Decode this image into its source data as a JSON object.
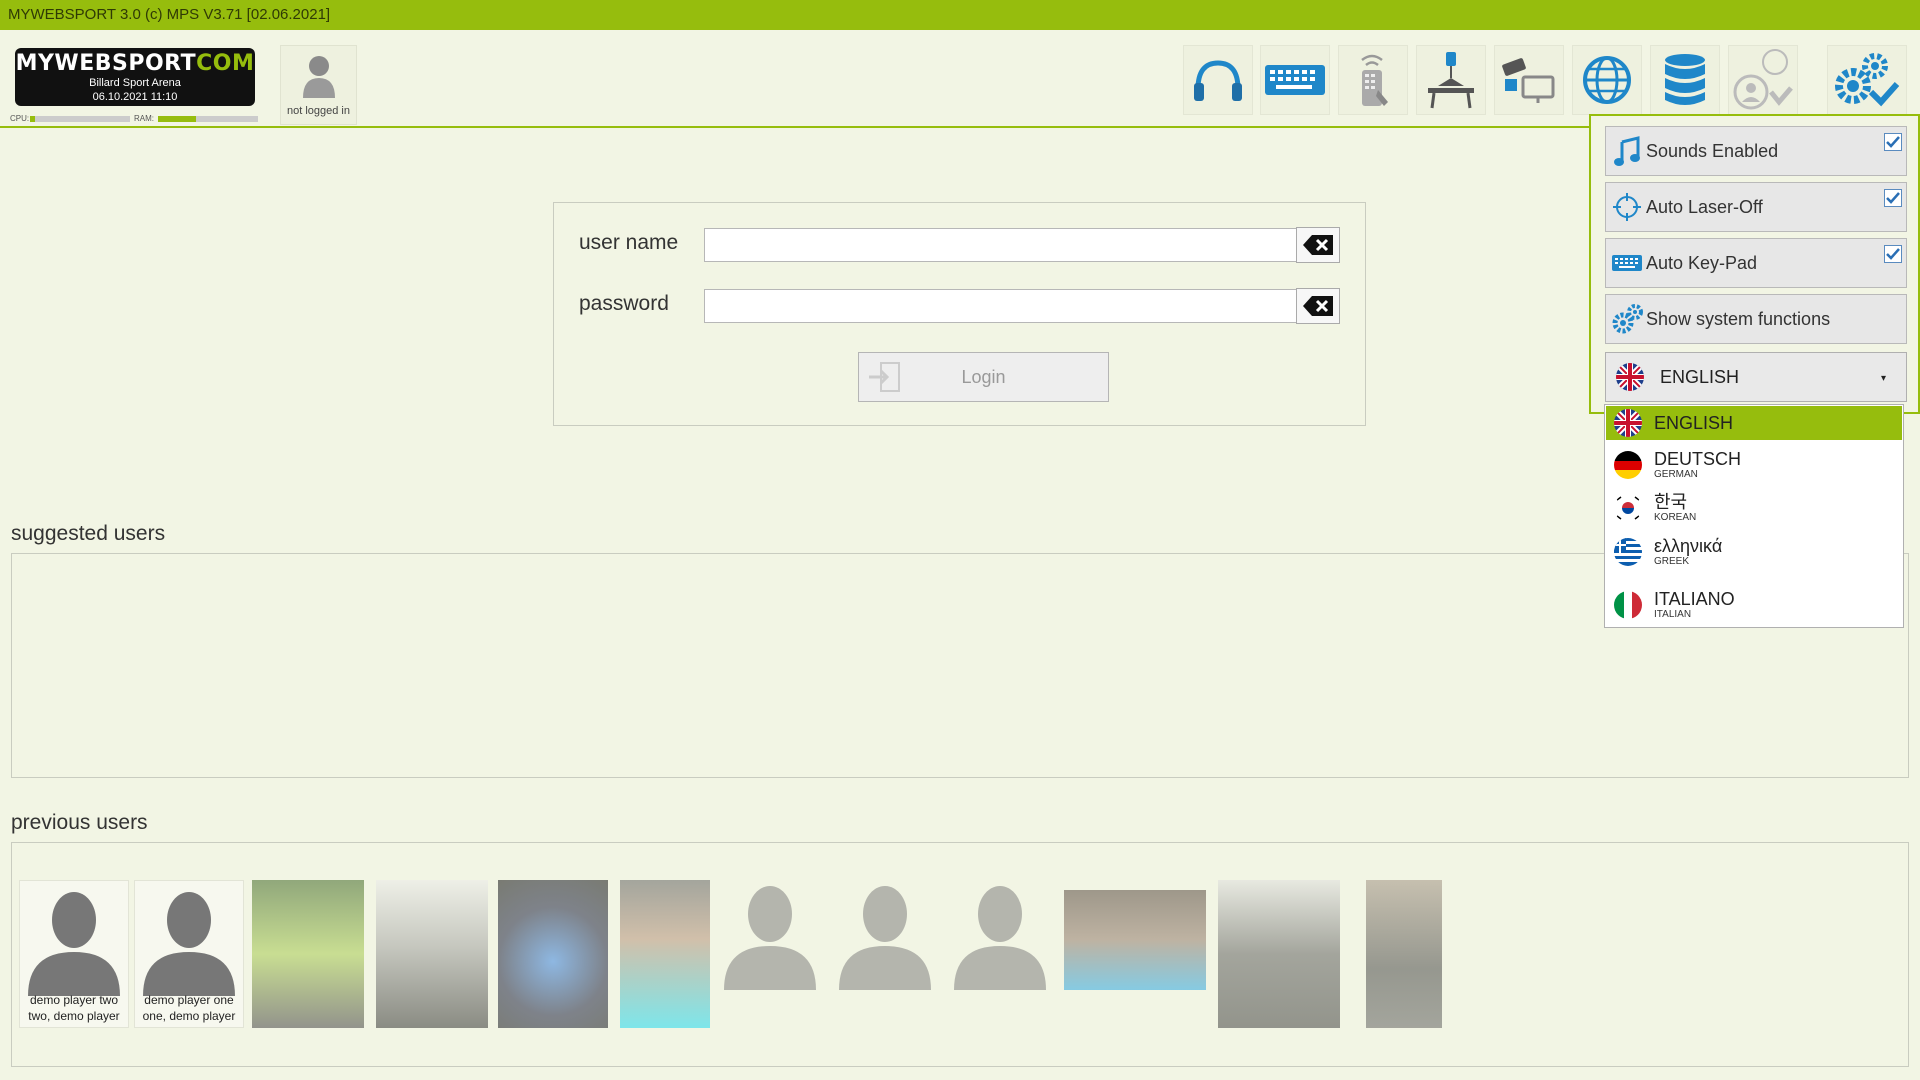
{
  "titlebar": {
    "text": "MYWEBSPORT 3.0  (c) MPS V3.71 [02.06.2021]"
  },
  "logo": {
    "brand_white": "MYWEBSPORT",
    "brand_green": "COM",
    "venue": "Billard Sport Arena",
    "datetime": "06.10.2021  11:10"
  },
  "meters": {
    "cpu_label": "CPU:",
    "ram_label": "RAM:",
    "cpu_level": 0.05,
    "ram_level": 0.38
  },
  "user_status": {
    "text": "not logged in"
  },
  "toolbar": {
    "icons": [
      "headphones-icon",
      "keyboard-icon",
      "remote-control-icon",
      "table-lamp-icon",
      "camera-monitor-icon",
      "globe-icon",
      "database-icon",
      "user-check-icon",
      "gears-check-icon"
    ]
  },
  "login": {
    "username_label": "user name",
    "password_label": "password",
    "username_value": "",
    "password_value": "",
    "login_button": "Login"
  },
  "suggested_users": {
    "label": "suggested users"
  },
  "previous_users": {
    "label": "previous users",
    "users": [
      {
        "line1": "demo player two",
        "line2": "two, demo player"
      },
      {
        "line1": "demo player one",
        "line2": "one, demo player"
      }
    ]
  },
  "settings": {
    "items": [
      {
        "label": "Sounds Enabled",
        "checked": true
      },
      {
        "label": "Auto Laser-Off",
        "checked": true
      },
      {
        "label": "Auto Key-Pad",
        "checked": true
      },
      {
        "label": "Show system functions",
        "checked": false
      }
    ],
    "language_selected": "ENGLISH",
    "languages": [
      {
        "name": "ENGLISH",
        "sub": ""
      },
      {
        "name": "DEUTSCH",
        "sub": "GERMAN"
      },
      {
        "name": "한국",
        "sub": "KOREAN"
      },
      {
        "name": "ελληνικά",
        "sub": "GREEK"
      },
      {
        "name": "ITALIANO",
        "sub": "ITALIAN"
      }
    ]
  },
  "colors": {
    "accent": "#96bd0d",
    "background": "#f2f5e4",
    "icon_blue": "#1f87c9"
  }
}
